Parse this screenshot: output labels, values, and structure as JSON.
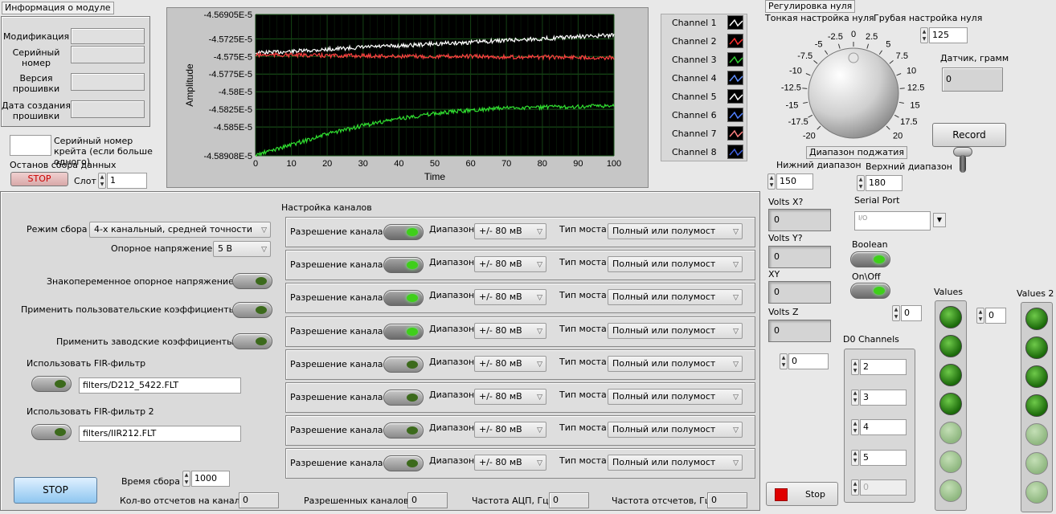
{
  "module_info": {
    "title": "Информация о модуле",
    "fields": [
      {
        "label": "Модификация",
        "value": ""
      },
      {
        "label": "Серийный номер",
        "value": ""
      },
      {
        "label": "Версия прошивки",
        "value": ""
      },
      {
        "label": "Дата создания прошивки",
        "value": ""
      }
    ],
    "crate_serial_label": "Серийный номер крейта (если больше одного)",
    "crate_serial_value": "",
    "stop_acq_label": "Останов сбора данных",
    "stop_button": "STOP",
    "slot_label": "Слот",
    "slot_value": "1"
  },
  "chart_data": {
    "type": "line",
    "ylabel": "Amplitude",
    "xlabel": "Time",
    "xlim": [
      0,
      100
    ],
    "ylim": [
      -4.58908e-05,
      -4.56905e-05
    ],
    "x_ticks": [
      "0",
      "10",
      "20",
      "30",
      "40",
      "50",
      "60",
      "70",
      "80",
      "90",
      "100"
    ],
    "y_ticks": [
      "-4.56905E-5",
      "-4.5725E-5",
      "-4.575E-5",
      "-4.5775E-5",
      "-4.58E-5",
      "-4.5825E-5",
      "-4.585E-5",
      "-4.58908E-5"
    ],
    "y_tick_values": [
      -4.56905e-05,
      -4.5725e-05,
      -4.575e-05,
      -4.5775e-05,
      -4.58e-05,
      -4.5825e-05,
      -4.585e-05,
      -4.58908e-05
    ],
    "series": [
      {
        "name": "Channel 1",
        "color": "#ffffff",
        "x": [
          0,
          10,
          20,
          30,
          40,
          50,
          60,
          70,
          80,
          90,
          100
        ],
        "y": [
          -4.5745e-05,
          -4.5743e-05,
          -4.574e-05,
          -4.5737e-05,
          -4.5735e-05,
          -4.5732e-05,
          -4.573e-05,
          -4.5727e-05,
          -4.5725e-05,
          -4.5722e-05,
          -4.572e-05
        ]
      },
      {
        "name": "Channel 2",
        "color": "#ff4040",
        "x": [
          0,
          10,
          20,
          30,
          40,
          50,
          60,
          70,
          80,
          90,
          100
        ],
        "y": [
          -4.5748e-05,
          -4.5748e-05,
          -4.5749e-05,
          -4.5749e-05,
          -4.575e-05,
          -4.575e-05,
          -4.575e-05,
          -4.5751e-05,
          -4.5751e-05,
          -4.5751e-05,
          -4.5752e-05
        ]
      },
      {
        "name": "Channel 3",
        "color": "#30e030",
        "x": [
          0,
          10,
          20,
          30,
          40,
          50,
          60,
          70,
          80,
          90,
          100
        ],
        "y": [
          -4.589e-05,
          -4.5875e-05,
          -4.586e-05,
          -4.5848e-05,
          -4.5838e-05,
          -4.5831e-05,
          -4.5826e-05,
          -4.5823e-05,
          -4.5822e-05,
          -4.5821e-05,
          -4.582e-05
        ]
      }
    ]
  },
  "legend": [
    {
      "name": "Channel 1",
      "color": "#ffffff"
    },
    {
      "name": "Channel 2",
      "color": "#ff3030"
    },
    {
      "name": "Channel 3",
      "color": "#30d030"
    },
    {
      "name": "Channel 4",
      "color": "#6090ff"
    },
    {
      "name": "Channel 5",
      "color": "#ffffff"
    },
    {
      "name": "Channel 6",
      "color": "#5080ff"
    },
    {
      "name": "Channel 7",
      "color": "#ff8080"
    },
    {
      "name": "Channel 8",
      "color": "#4060e0"
    }
  ],
  "zero": {
    "title": "Регулировка нуля",
    "fine_label": "Тонкая настройка нуля",
    "coarse_label": "Грубая настройка нуля",
    "coarse_value": "125",
    "knob_labels": [
      "-20",
      "-17.5",
      "-15",
      "-12.5",
      "-10",
      "-7.5",
      "-5",
      "-2.5",
      "0",
      "2.5",
      "5",
      "7.5",
      "10",
      "12.5",
      "15",
      "17.5",
      "20"
    ],
    "sensor_label": "Датчик, грамм",
    "sensor_value": "0",
    "record_button": "Record",
    "range_label": "Диапазон поджатия",
    "low_label": "Нижний диапазон",
    "low_value": "150",
    "high_label": "Верхний диапазон",
    "high_value": "180"
  },
  "side": {
    "volts_x_label": "Volts X?",
    "volts_x": "0",
    "volts_y_label": "Volts Y?",
    "volts_y": "0",
    "xy_label": "XY",
    "xy": "0",
    "volts_z_label": "Volts Z",
    "volts_z": "0",
    "serial_label": "Serial Port",
    "serial_value": "",
    "boolean_label": "Boolean",
    "onoff_label": "On\\Off",
    "values_label": "Values",
    "values2_label": "Values 2",
    "values_idx": "0",
    "values2_idx": "0",
    "d0_label": "D0 Channels",
    "d0_idx": "0",
    "d0_items": [
      "2",
      "3",
      "4",
      "5",
      "0"
    ],
    "values_leds": [
      1,
      1,
      1,
      1,
      0,
      0,
      0
    ],
    "values2_leds": [
      1,
      1,
      1,
      1,
      0,
      0,
      0
    ],
    "stop_label": "Stop"
  },
  "config": {
    "mode_label": "Режим сбора",
    "mode_value": "4-х канальный, средней точности",
    "ref_label": "Опорное напряжение",
    "ref_value": "5 В",
    "alt_ref_label": "Знакопеременное опорное напряжение",
    "user_coef_label": "Применить пользовательские коэффициенты",
    "factory_coef_label": "Применить заводские коэффициенты",
    "fir_label": "Использовать FIR-фильтр",
    "fir_value": "filters/D212_5422.FLT",
    "fir2_label": "Использовать FIR-фильтр 2",
    "fir2_value": "filters/IIR212.FLT",
    "stop_button": "STOP",
    "acq_time_label": "Время сбора",
    "acq_time_value": "1000",
    "samples_label": "Кол-во отсчетов на канал",
    "samples_value": "0",
    "enabled_label": "Разрешенных каналов",
    "enabled_value": "0",
    "adc_freq_label": "Частота АЦП, Гц",
    "adc_freq_value": "0",
    "sample_freq_label": "Частота отсчетов, Гц",
    "sample_freq_value": "0",
    "channels_title": "Настройка каналов",
    "channel_rows": [
      {
        "enable_label": "Разрешение канала",
        "enabled": true,
        "range_label": "Диапазон",
        "range": "+/- 80 мВ",
        "bridge_label": "Тип моста",
        "bridge": "Полный или полумост"
      },
      {
        "enable_label": "Разрешение канала",
        "enabled": true,
        "range_label": "Диапазон",
        "range": "+/- 80 мВ",
        "bridge_label": "Тип моста",
        "bridge": "Полный или полумост"
      },
      {
        "enable_label": "Разрешение канала",
        "enabled": true,
        "range_label": "Диапазон",
        "range": "+/- 80 мВ",
        "bridge_label": "Тип моста",
        "bridge": "Полный или полумост"
      },
      {
        "enable_label": "Разрешение канала",
        "enabled": true,
        "range_label": "Диапазон",
        "range": "+/- 80 мВ",
        "bridge_label": "Тип моста",
        "bridge": "Полный или полумост"
      },
      {
        "enable_label": "Разрешение канала",
        "enabled": false,
        "range_label": "Диапазон",
        "range": "+/- 80 мВ",
        "bridge_label": "Тип моста",
        "bridge": "Полный или полумост"
      },
      {
        "enable_label": "Разрешение канала",
        "enabled": false,
        "range_label": "Диапазон",
        "range": "+/- 80 мВ",
        "bridge_label": "Тип моста",
        "bridge": "Полный или полумост"
      },
      {
        "enable_label": "Разрешение канала",
        "enabled": false,
        "range_label": "Диапазон",
        "range": "+/- 80 мВ",
        "bridge_label": "Тип моста",
        "bridge": "Полный или полумост"
      },
      {
        "enable_label": "Разрешение канала",
        "enabled": false,
        "range_label": "Диапазон",
        "range": "+/- 80 мВ",
        "bridge_label": "Тип моста",
        "bridge": "Полный или полумост"
      }
    ]
  }
}
